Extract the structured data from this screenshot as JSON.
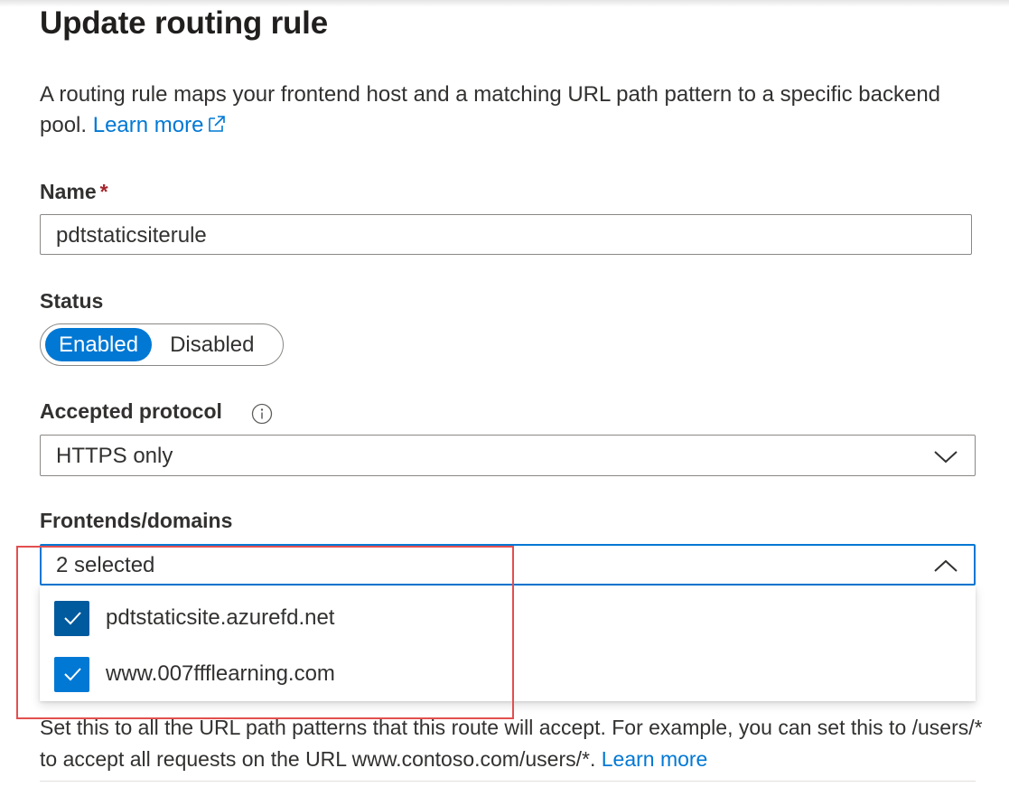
{
  "title": "Update routing rule",
  "description": {
    "text": "A routing rule maps your frontend host and a matching URL path pattern to a specific backend pool.",
    "link": "Learn more"
  },
  "name_field": {
    "label": "Name",
    "required_mark": "*",
    "value": "pdtstaticsiterule"
  },
  "status": {
    "label": "Status",
    "options": [
      "Enabled",
      "Disabled"
    ],
    "selected": "Enabled"
  },
  "protocol": {
    "label": "Accepted protocol",
    "value": "HTTPS only"
  },
  "frontends": {
    "label": "Frontends/domains",
    "value": "2 selected",
    "options": [
      {
        "label": "pdtstaticsite.azurefd.net",
        "checked": true
      },
      {
        "label": "www.007ffflearning.com",
        "checked": true
      }
    ]
  },
  "help_text": {
    "text": "Set this to all the URL path patterns that this route will accept. For example, you can set this to /users/* to accept all requests on the URL www.contoso.com/users/*.",
    "link": "Learn more"
  },
  "colors": {
    "accent": "#0078d4",
    "highlight": "#e24f4f",
    "required": "#a4262c"
  }
}
